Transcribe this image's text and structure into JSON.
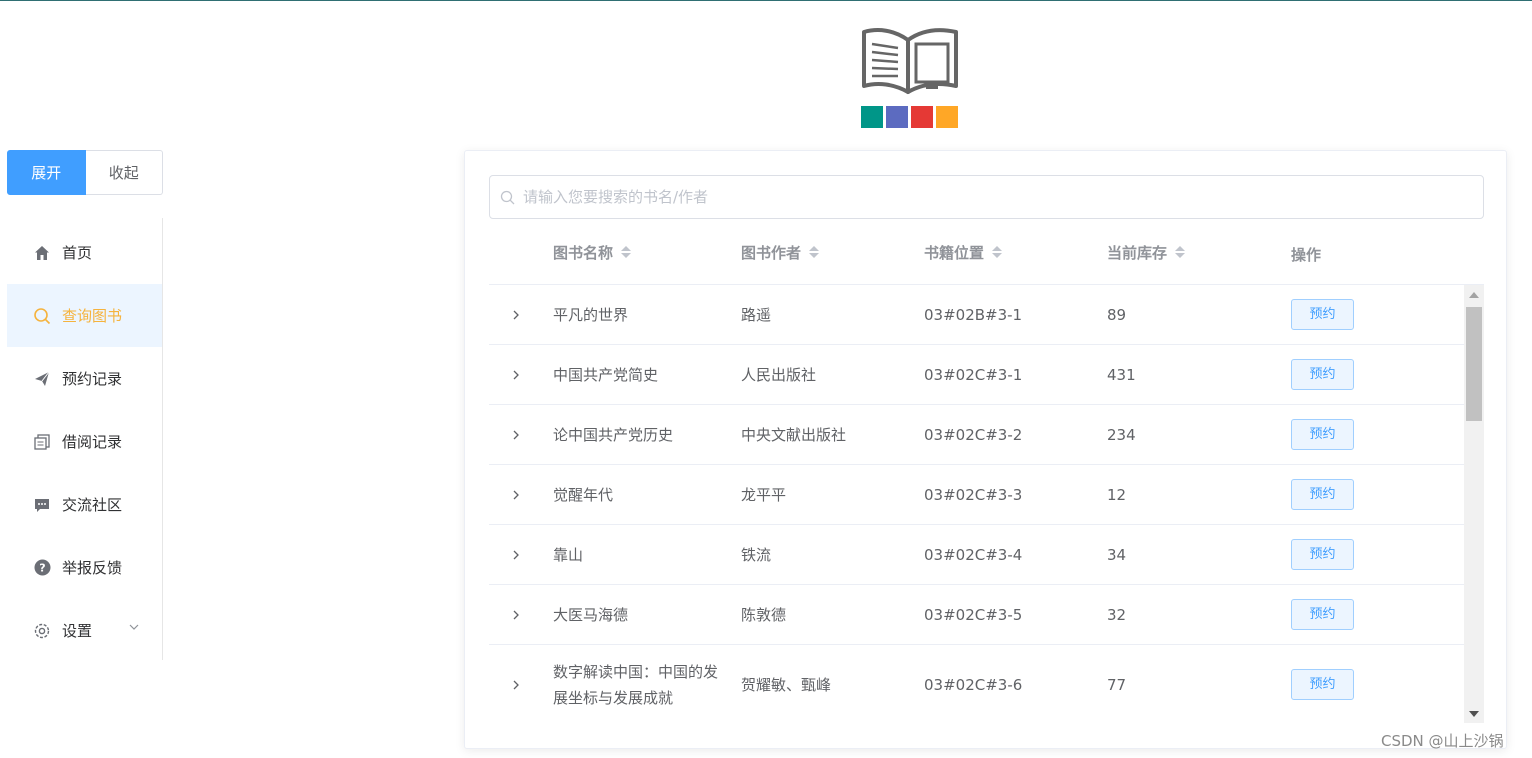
{
  "logo": {
    "icon": "open-book-logo",
    "colors": [
      "#009688",
      "#5c6bc0",
      "#e53935",
      "#ffa726"
    ]
  },
  "toggle": {
    "expand_label": "展开",
    "collapse_label": "收起"
  },
  "sidebar": {
    "items": [
      {
        "label": "首页",
        "icon": "home-icon"
      },
      {
        "label": "查询图书",
        "icon": "search-icon",
        "active": true
      },
      {
        "label": "预约记录",
        "icon": "send-icon"
      },
      {
        "label": "借阅记录",
        "icon": "document-copy-icon"
      },
      {
        "label": "交流社区",
        "icon": "chat-icon"
      },
      {
        "label": "举报反馈",
        "icon": "question-icon"
      },
      {
        "label": "设置",
        "icon": "gear-icon"
      }
    ]
  },
  "search": {
    "placeholder": "请输入您要搜索的书名/作者",
    "value": ""
  },
  "table": {
    "columns": [
      "图书名称",
      "图书作者",
      "书籍位置",
      "当前库存",
      "操作"
    ],
    "rows": [
      {
        "name": "平凡的世界",
        "author": "路遥",
        "location": "03#02B#3-1",
        "stock": "89",
        "action": "预约"
      },
      {
        "name": "中国共产党简史",
        "author": "人民出版社",
        "location": "03#02C#3-1",
        "stock": "431",
        "action": "预约"
      },
      {
        "name": "论中国共产党历史",
        "author": "中央文献出版社",
        "location": "03#02C#3-2",
        "stock": "234",
        "action": "预约"
      },
      {
        "name": "觉醒年代",
        "author": "龙平平",
        "location": "03#02C#3-3",
        "stock": "12",
        "action": "预约"
      },
      {
        "name": "靠山",
        "author": "铁流",
        "location": "03#02C#3-4",
        "stock": "34",
        "action": "预约"
      },
      {
        "name": "大医马海德",
        "author": "陈敦德",
        "location": "03#02C#3-5",
        "stock": "32",
        "action": "预约"
      },
      {
        "name": "数字解读中国：中国的发展坐标与发展成就",
        "author": "贺耀敏、甄峰",
        "location": "03#02C#3-6",
        "stock": "77",
        "action": "预约"
      }
    ]
  },
  "watermark": "CSDN @山上沙锅",
  "colors": {
    "primary": "#409eff",
    "active_text": "#f5b33e",
    "active_bg": "#ecf5ff"
  }
}
